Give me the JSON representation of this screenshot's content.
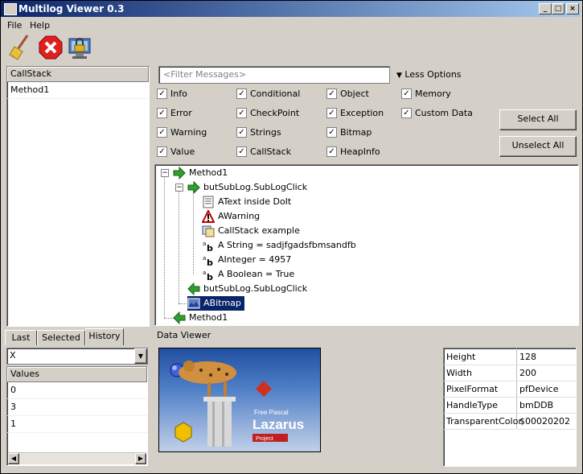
{
  "window": {
    "title": "Multilog Viewer 0.3"
  },
  "menu": {
    "file": "File",
    "help": "Help"
  },
  "toolbar": {
    "clear_icon": "broom-icon",
    "stop_icon": "stop-x-icon",
    "lock_icon": "monitor-lock-icon"
  },
  "callstack": {
    "header": "CallStack",
    "items": [
      "Method1"
    ]
  },
  "filter": {
    "placeholder": "<Filter Messages>",
    "options_label": "Less Options"
  },
  "checkboxes": {
    "info": "Info",
    "error": "Error",
    "warning": "Warning",
    "value": "Value",
    "conditional": "Conditional",
    "checkpoint": "CheckPoint",
    "strings": "Strings",
    "callstack": "CallStack",
    "object": "Object",
    "exception": "Exception",
    "bitmap": "Bitmap",
    "heapinfo": "HeapInfo",
    "memory": "Memory",
    "customdata": "Custom Data"
  },
  "buttons": {
    "select_all": "Select All",
    "unselect_all": "Unselect All"
  },
  "tree": {
    "n1": "Method1",
    "n2": "butSubLog.SubLogClick",
    "n3": "AText inside DoIt",
    "n4": "AWarning",
    "n5": "CallStack example",
    "n6": "A String = sadjfgadsfbmsandfb",
    "n7": "AInteger = 4957",
    "n8": "A Boolean = True",
    "n9": "butSubLog.SubLogClick",
    "n10": "ABitmap",
    "n11": "Method1"
  },
  "bottom_tabs": {
    "last": "Last",
    "selected": "Selected",
    "history": "History"
  },
  "history": {
    "combo_value": "X",
    "values_header": "Values",
    "values": [
      "0",
      "3",
      "1"
    ]
  },
  "data_viewer": {
    "title": "Data Viewer",
    "image": {
      "line1": "Free Pascal",
      "line2": "Lazarus",
      "line3": "Project"
    },
    "props": [
      {
        "k": "Height",
        "v": "128"
      },
      {
        "k": "Width",
        "v": "200"
      },
      {
        "k": "PixelFormat",
        "v": "pfDevice"
      },
      {
        "k": "HandleType",
        "v": "bmDDB"
      },
      {
        "k": "TransparentColor",
        "v": "$00020202"
      }
    ]
  }
}
